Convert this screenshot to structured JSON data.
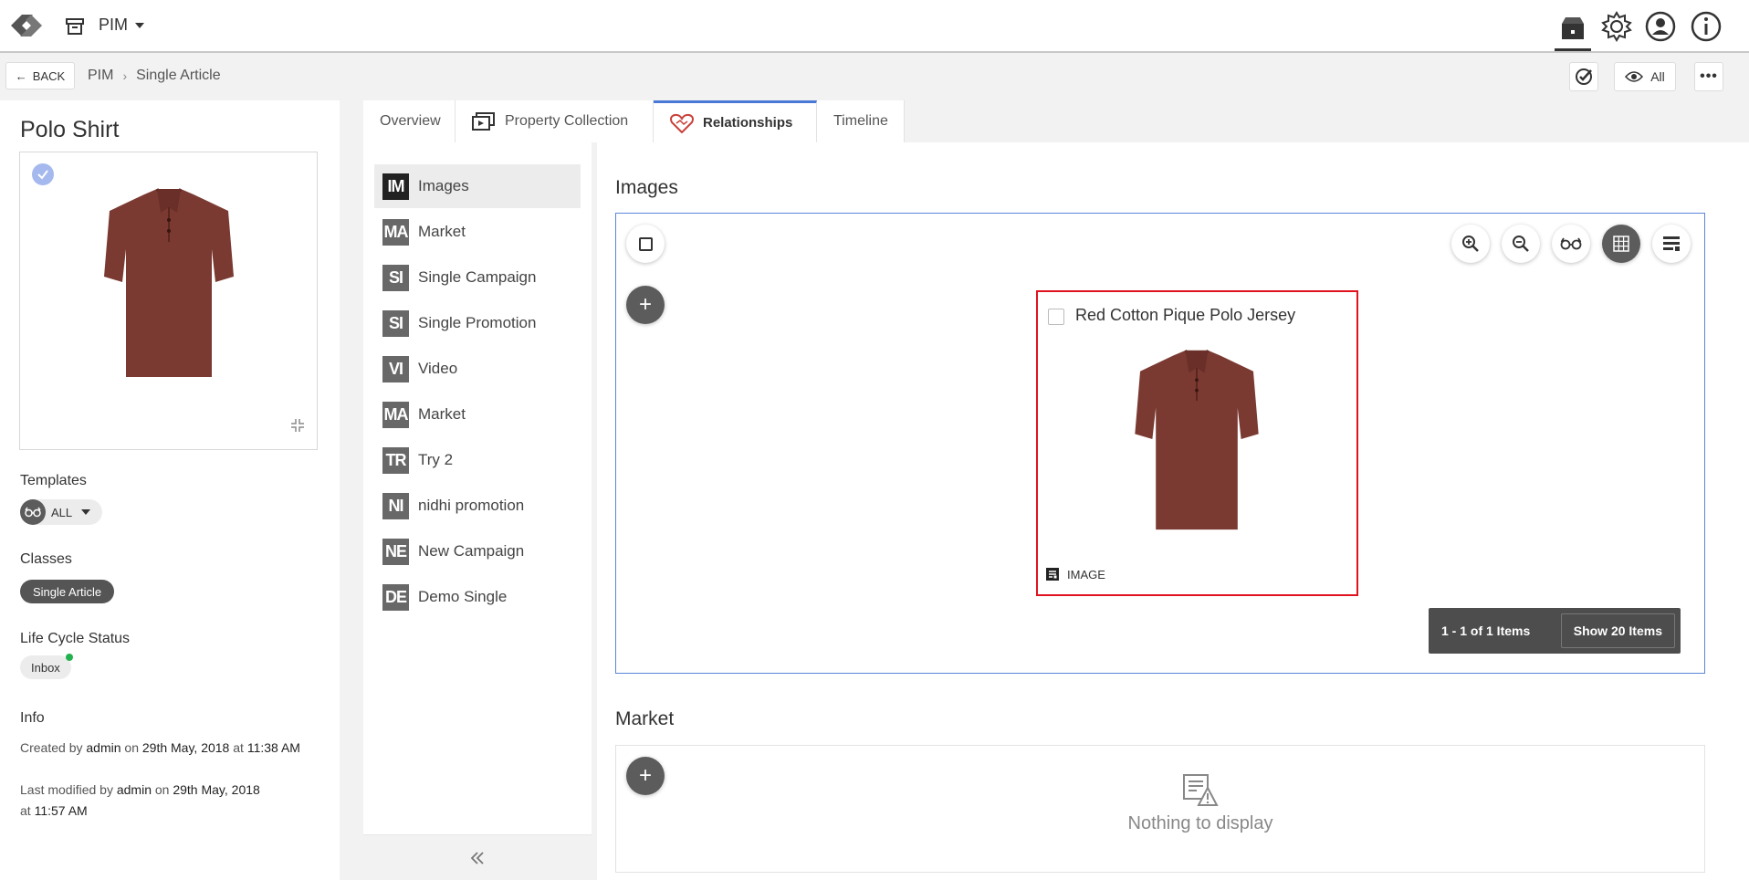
{
  "topbar": {
    "app_name": "PIM",
    "icons": [
      "logo-icon",
      "archive-icon",
      "product-box-icon",
      "gear-icon",
      "user-icon",
      "info-icon"
    ]
  },
  "subbar": {
    "back_label": "BACK",
    "breadcrumb": [
      "PIM",
      "Single Article"
    ],
    "view_filter_label": "All"
  },
  "article": {
    "title": "Polo Shirt",
    "templates_label": "Templates",
    "templates_value": "ALL",
    "classes_label": "Classes",
    "class_value": "Single Article",
    "lifecycle_label": "Life Cycle Status",
    "lifecycle_value": "Inbox",
    "info_label": "Info",
    "created_prefix": "Created by",
    "created_by": "admin",
    "created_on_word": "on",
    "created_date": "29th May, 2018",
    "created_at_word": "at",
    "created_time": "11:38 AM",
    "modified_prefix": "Last modified by",
    "modified_by": "admin",
    "modified_on_word": "on",
    "modified_date": "29th May, 2018",
    "modified_at_word": "at",
    "modified_time": "11:57 AM"
  },
  "tabs": [
    {
      "label": "Overview"
    },
    {
      "label": "Property Collection"
    },
    {
      "label": "Relationships"
    },
    {
      "label": "Timeline"
    }
  ],
  "relationships": [
    {
      "code": "IM",
      "label": "Images"
    },
    {
      "code": "MA",
      "label": "Market"
    },
    {
      "code": "SI",
      "label": "Single Campaign"
    },
    {
      "code": "SI",
      "label": "Single Promotion"
    },
    {
      "code": "VI",
      "label": "Video"
    },
    {
      "code": "MA",
      "label": "Market"
    },
    {
      "code": "TR",
      "label": "Try 2"
    },
    {
      "code": "NI",
      "label": "nidhi promotion"
    },
    {
      "code": "NE",
      "label": "New Campaign"
    },
    {
      "code": "DE",
      "label": "Demo Single"
    }
  ],
  "images_section": {
    "title": "Images",
    "card_title": "Red Cotton Pique Polo Jersey",
    "card_type": "IMAGE",
    "pager_range": "1 - 1 of 1 Items",
    "pager_show": "Show 20 Items"
  },
  "market_section": {
    "title": "Market",
    "empty_text": "Nothing to display"
  },
  "colors": {
    "accent_blue": "#4a78d6",
    "selection_red": "#e0121e",
    "shirt_red": "#7a3a32",
    "status_green": "#22b14c"
  }
}
